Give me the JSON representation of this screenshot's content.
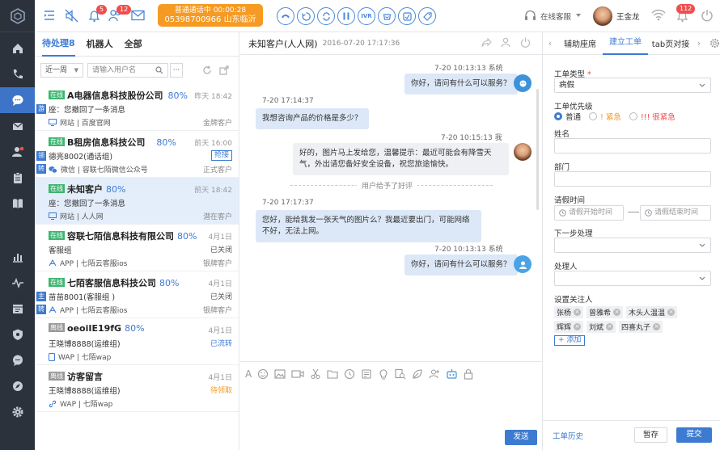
{
  "topbar": {
    "call_status": "普通通话中  00:00:28",
    "call_number": "05398700966 山东临沂",
    "badge_a": "5",
    "badge_b": "12",
    "badge_c": "112",
    "service_status": "在线客服",
    "agent_name": "王金龙",
    "call_buttons": [
      "IVR"
    ]
  },
  "list": {
    "tabs": [
      "待处理8",
      "机器人",
      "全部"
    ],
    "period": "近一周",
    "search_placeholder": "请输入用户名",
    "items": [
      {
        "status": "在线",
        "title": "A电器信息科技股份公司",
        "pct": "80%",
        "time": "昨天 18:42",
        "side": "游",
        "line2": "座：您撤回了一条消息",
        "line3": "网站 | 百度官网",
        "right3": "金牌客户",
        "right2": ""
      },
      {
        "status": "在线",
        "title": "B租房信息科技公司",
        "pct": "80%",
        "time": "前天 16:00",
        "side": "领",
        "side2": "转",
        "line2": "德亮8002(通话组)",
        "line3": "微信 | 容联七陌微信公众号",
        "right2": "抢接",
        "right3": "正式客户"
      },
      {
        "status": "在线",
        "title": "未知客户",
        "pct": "80%",
        "time": "前天 18:42",
        "line2": "座：您撤回了一条消息",
        "line3": "网站 | 人人网",
        "right2": "",
        "right3": "潜在客户"
      },
      {
        "status": "在线",
        "title": "容联七陌信息科技有限公司",
        "pct": "80%",
        "time": "4月1日",
        "line2": "客服组",
        "line3": "APP | 七陌云客服ios",
        "right2": "已关闭",
        "right3": "银牌客户"
      },
      {
        "status": "在线",
        "title": "七陌客服信息科技公司",
        "pct": "80%",
        "time": "4月1日",
        "side": "主",
        "side2": "转",
        "line2": "苗苗8001(客服组 )",
        "line3": "APP | 七陌云客服ios",
        "right2": "已关闭",
        "right3": "银牌客户"
      },
      {
        "status": "离线",
        "title": "oeoiIE19fG",
        "pct": "80%",
        "time": "4月1日",
        "line2": "王晓博8888(运维组)",
        "line3": "WAP | 七陌wap",
        "right2": "已流转",
        "right3": ""
      },
      {
        "status": "离线",
        "title": "访客留言",
        "pct": "",
        "time": "4月1日",
        "line2": "王晓博8888(运维组)",
        "line3": "WAP | 七陌wap",
        "right2": "待领取",
        "right3": ""
      }
    ]
  },
  "chat": {
    "title": "未知客户(人人网)",
    "date": "2016-07-20 17:17:36",
    "messages": {
      "m1_meta": "7-20  10:13:13  系统",
      "m1_text": "你好，请问有什么可以服务？",
      "m2_meta": "7-20  17:14:37",
      "m2_text": "我想咨询产品的价格是多少？",
      "m3_meta": "7-20   10:15:13  我",
      "m3_text": "好的，图片马上发给您，温馨提示：最近可能会有降雪天气，外出请您备好安全设备，祝您旅途愉快。",
      "divider": "用户给予了好评",
      "m4_meta": "7-20  17:17:37",
      "m4_text": "您好，能给我发一张天气的图片么？我最近要出门，可能网络不好，无法上网。",
      "m5_meta": "7-20  10:13:13  系统",
      "m5_text": "你好，请问有什么可以服务？"
    },
    "send_label": "发送"
  },
  "ticket": {
    "tabs": [
      "辅助座席",
      "建立工单",
      "tab页对接"
    ],
    "type_label": "工单类型",
    "type_value": "病假",
    "priority_label": "工单优先级",
    "priorities": [
      "普通",
      "! 紧急",
      "!!! 很紧急"
    ],
    "name_label": "姓名",
    "dept_label": "部门",
    "time_label": "请假时间",
    "start_placeholder": "请假开始时间",
    "end_placeholder": "请假结束时间",
    "next_label": "下一步处理",
    "handler_label": "处理人",
    "watch_label": "设置关注人",
    "watchers": [
      "张杨",
      "曾雅希",
      "木头人温温",
      "辉辉",
      "刘斌",
      "四喜丸子"
    ],
    "add_label": "+ 添加",
    "history": "工单历史",
    "save": "暂存",
    "submit": "提交"
  },
  "colors": {
    "accent": "#3d7bd2",
    "nav_bg": "#2b323c",
    "call_orange": "#f59a23"
  }
}
